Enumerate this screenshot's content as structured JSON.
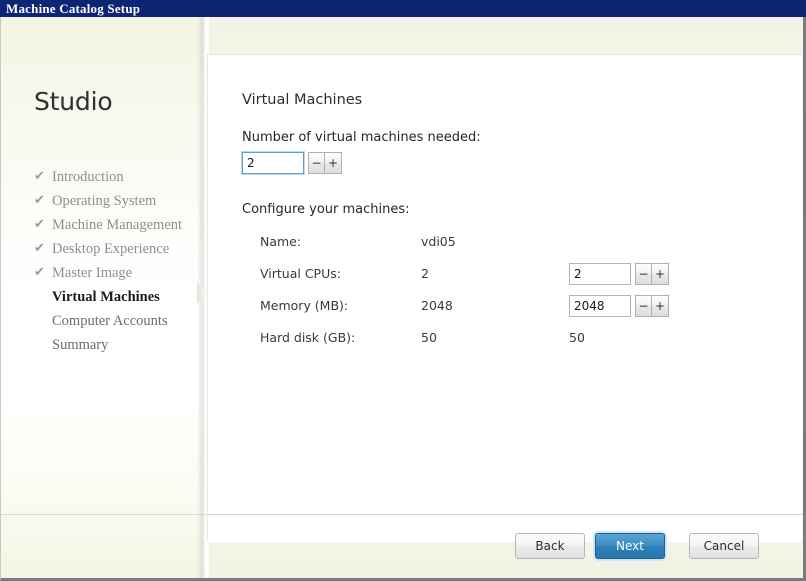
{
  "window": {
    "title": "Machine Catalog Setup"
  },
  "sidebar": {
    "brand": "Studio",
    "items": [
      {
        "label": "Introduction",
        "state": "done",
        "check": "✔"
      },
      {
        "label": "Operating System",
        "state": "done",
        "check": "✔"
      },
      {
        "label": "Machine Management",
        "state": "done",
        "check": "✔"
      },
      {
        "label": "Desktop Experience",
        "state": "done",
        "check": "✔"
      },
      {
        "label": "Master Image",
        "state": "done",
        "check": "✔"
      },
      {
        "label": "Virtual Machines",
        "state": "current",
        "check": ""
      },
      {
        "label": "Computer Accounts",
        "state": "pending",
        "check": ""
      },
      {
        "label": "Summary",
        "state": "pending",
        "check": ""
      }
    ]
  },
  "main": {
    "heading": "Virtual Machines",
    "count_label": "Number of virtual machines needed:",
    "count_value": "2",
    "spinner_minus": "−",
    "spinner_plus": "+",
    "configure_label": "Configure your machines:",
    "rows": [
      {
        "label": "Name:",
        "value": "vdi05",
        "right": "",
        "has_spinner": false
      },
      {
        "label": "Virtual CPUs:",
        "value": "2",
        "right": "2",
        "has_spinner": true
      },
      {
        "label": "Memory (MB):",
        "value": "2048",
        "right": "2048",
        "has_spinner": true
      },
      {
        "label": "Hard disk (GB):",
        "value": "50",
        "right": "50",
        "has_spinner": false
      }
    ]
  },
  "footer": {
    "back": "Back",
    "next": "Next",
    "cancel": "Cancel"
  },
  "colors": {
    "titlebar": "#0d2573",
    "primary_button": "#2f80b8",
    "focus_border": "#5f9ec9"
  }
}
